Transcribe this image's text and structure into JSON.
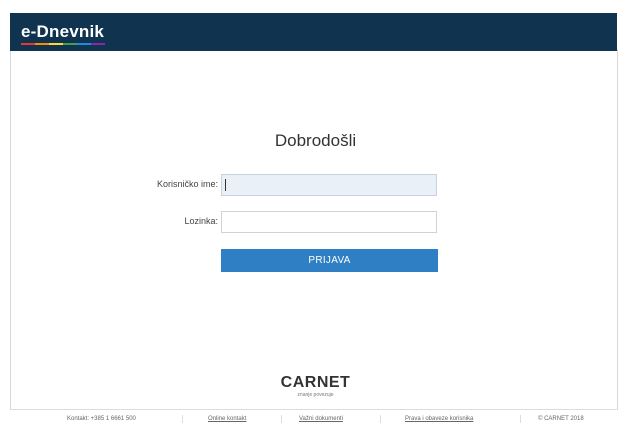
{
  "header": {
    "logo_text": "e-Dnevnik",
    "logo_colors": [
      "#e53935",
      "#fb8c00",
      "#fdd835",
      "#43a047",
      "#1e88e5",
      "#8e24aa"
    ],
    "background": "#10344f"
  },
  "main": {
    "title": "Dobrodošli",
    "username_label": "Korisničko ime:",
    "username_value": "",
    "password_label": "Lozinka:",
    "password_value": "",
    "login_button": "PRIJAVA",
    "accent": "#2e7fc4"
  },
  "brand": {
    "name": "CARNET",
    "tagline": "znanje povezuje"
  },
  "footer": {
    "contact": "Kontakt: +385 1 6661 500",
    "online_contact": "Online kontakt",
    "documents": "Važni dokumenti",
    "rights": "Prava i obaveze korisnika",
    "copyright": "© CARNET 2018"
  }
}
